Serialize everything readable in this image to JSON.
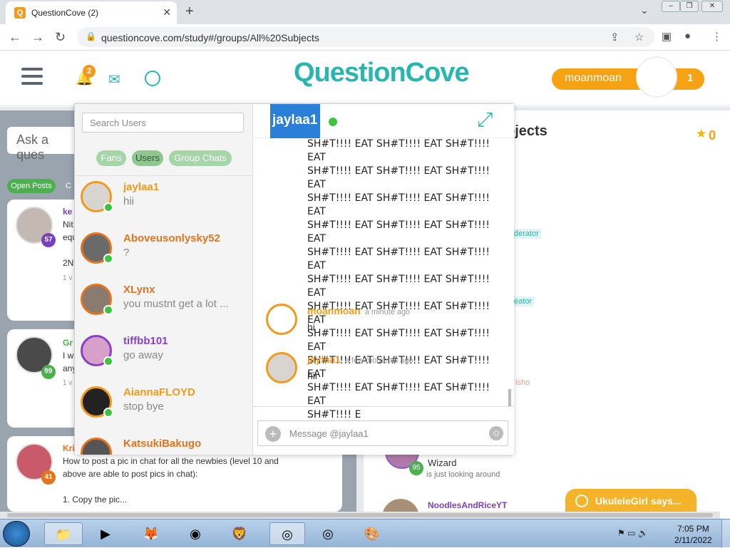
{
  "browser": {
    "tab_title": "QuestionCove (2)",
    "url": "questioncove.com/study#/groups/All%20Subjects"
  },
  "header": {
    "notification_count": "2",
    "logo": "QuestionCove",
    "username": "moanmoan",
    "user_points": "1"
  },
  "background": {
    "ask_placeholder": "Ask a ques",
    "tabs": [
      "Open Posts",
      "C"
    ],
    "posts": [
      {
        "name_fragment": "ke",
        "lines": [
          "Nit",
          "equ",
          "",
          "2N",
          "1 v"
        ],
        "level": "57"
      },
      {
        "name_fragment": "Gr",
        "lines": [
          "I w",
          "any",
          "1 v"
        ],
        "level": "99"
      },
      {
        "name_fragment": "Kri",
        "lines": [
          "How to post a pic in chat for all the newbies (level 10 and",
          "above are able to post pics in chat):",
          "",
          "1. Copy the pic..."
        ],
        "level": "41"
      }
    ],
    "right_title": "ojects",
    "star_count": "0",
    "role_tags": [
      "derator",
      "eator",
      "isho"
    ],
    "wizard": {
      "name": "Wizard",
      "status": "is just looking around",
      "level": "95"
    },
    "noodles_name": "NoodlesAndRiceYT",
    "notification_popup": "UkuleleGirl says..."
  },
  "chat": {
    "search_placeholder": "Search Users",
    "filters": [
      "Fans",
      "Users",
      "Group Chats"
    ],
    "contacts": [
      {
        "name": "jaylaa1",
        "message": "hii",
        "name_color": "#f39a1c"
      },
      {
        "name": "Aboveusonlysky52",
        "message": "?",
        "name_color": "#e6741c"
      },
      {
        "name": "XLynx",
        "message": "you mustnt get a lot ...",
        "name_color": "#e6741c"
      },
      {
        "name": "tiffbb101",
        "message": "go away",
        "name_color": "#8b3fc8"
      },
      {
        "name": "AiannaFLOYD",
        "message": "stop bye",
        "name_color": "#f39a1c"
      },
      {
        "name": "KatsukiBakugo",
        "message": "",
        "name_color": "#e6741c"
      }
    ],
    "active_user": "jaylaa1",
    "spam_lines": [
      "SH#T!!!! EAT SH#T!!!! EAT SH#T!!!! EAT",
      "SH#T!!!! EAT SH#T!!!! EAT SH#T!!!! EAT",
      "SH#T!!!! EAT SH#T!!!! EAT SH#T!!!! EAT",
      "SH#T!!!! EAT SH#T!!!! EAT SH#T!!!! EAT",
      "SH#T!!!! EAT SH#T!!!! EAT SH#T!!!! EAT",
      "SH#T!!!! EAT SH#T!!!! EAT SH#T!!!! EAT",
      "SH#T!!!! EAT SH#T!!!! EAT SH#T!!!! EAT",
      "SH#T!!!! EAT SH#T!!!! EAT SH#T!!!! EAT",
      "SH#T!!!! EAT SH#T!!!! EAT SH#T!!!! EAT",
      "SH#T!!!! EAT SH#T!!!! EAT SH#T!!!! EAT",
      "SH#T!!!! E"
    ],
    "messages": [
      {
        "name": "moanmoan",
        "time": "a minute ago",
        "text": "hi"
      },
      {
        "name": "jaylaa1",
        "time": "a few moments ago",
        "text": "hii"
      }
    ],
    "message_placeholder": "Message @jaylaa1"
  },
  "taskbar": {
    "time": "7:05 PM",
    "date": "2/11/2022"
  }
}
